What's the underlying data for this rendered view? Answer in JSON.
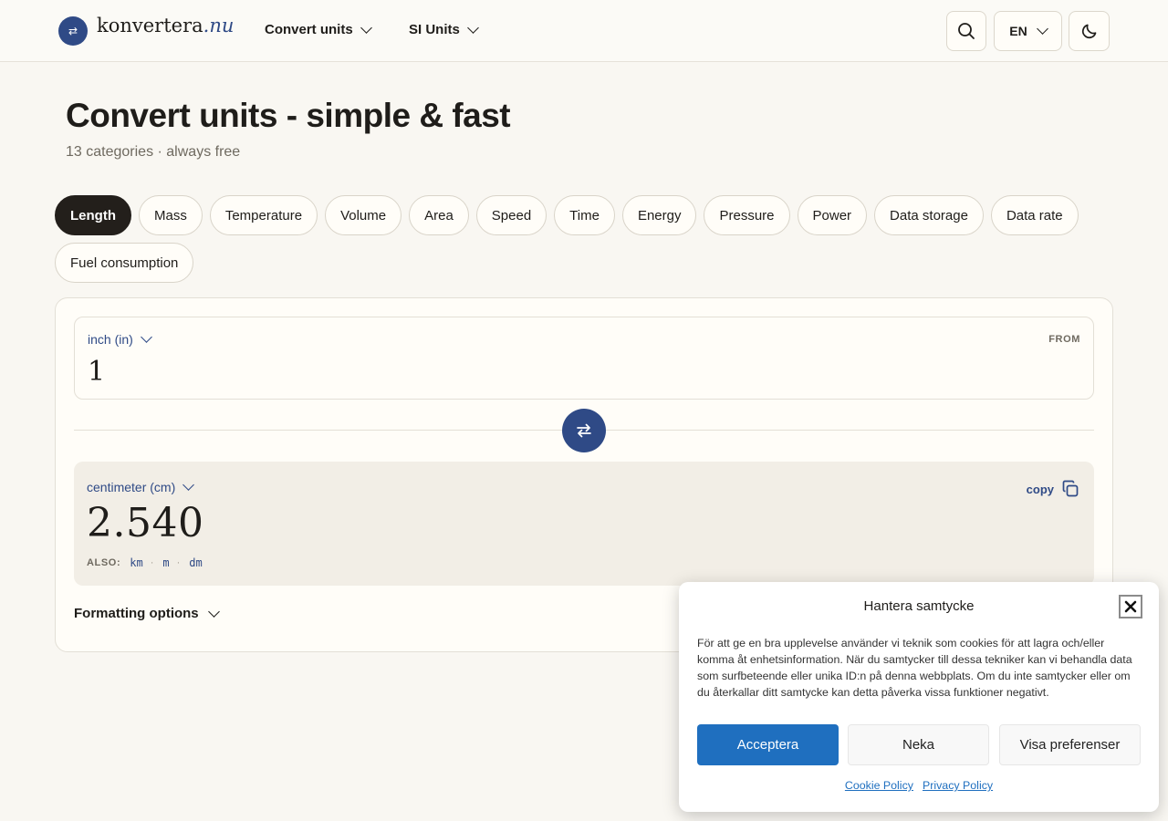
{
  "header": {
    "logo_mark": "⇄",
    "logo_name": "konvertera",
    "logo_tld": ".nu",
    "nav": [
      "Convert units",
      "SI Units"
    ],
    "language": "EN"
  },
  "hero": {
    "title": "Convert units - simple & fast",
    "subtitle": "13 categories · always free"
  },
  "categories": [
    {
      "label": "Length",
      "active": true
    },
    {
      "label": "Mass"
    },
    {
      "label": "Temperature"
    },
    {
      "label": "Volume"
    },
    {
      "label": "Area"
    },
    {
      "label": "Speed"
    },
    {
      "label": "Time"
    },
    {
      "label": "Energy"
    },
    {
      "label": "Pressure"
    },
    {
      "label": "Power"
    },
    {
      "label": "Data storage"
    },
    {
      "label": "Data rate"
    },
    {
      "label": "Fuel consumption"
    }
  ],
  "converter": {
    "from_unit": "inch (in)",
    "from_label": "FROM",
    "from_value": "1",
    "to_unit": "centimeter (cm)",
    "copy_label": "copy",
    "result": "2.540",
    "also_label": "ALSO:",
    "also_units": [
      "km",
      "m",
      "dm"
    ],
    "formatting_label": "Formatting options"
  },
  "cookie": {
    "title": "Hantera samtycke",
    "body": "För att ge en bra upplevelse använder vi teknik som cookies för att lagra och/eller komma åt enhetsinformation. När du samtycker till dessa tekniker kan vi behandla data som surfbeteende eller unika ID:n på denna webbplats. Om du inte samtycker eller om du återkallar ditt samtycke kan detta påverka vissa funktioner negativt.",
    "accept": "Acceptera",
    "deny": "Neka",
    "preferences": "Visa preferenser",
    "links": [
      "Cookie Policy",
      "Privacy Policy"
    ]
  },
  "colors": {
    "accent": "#2f4a86",
    "active_pill": "#231f1b",
    "cookie_primary": "#1f6fbf",
    "background": "#f9f7f2"
  }
}
